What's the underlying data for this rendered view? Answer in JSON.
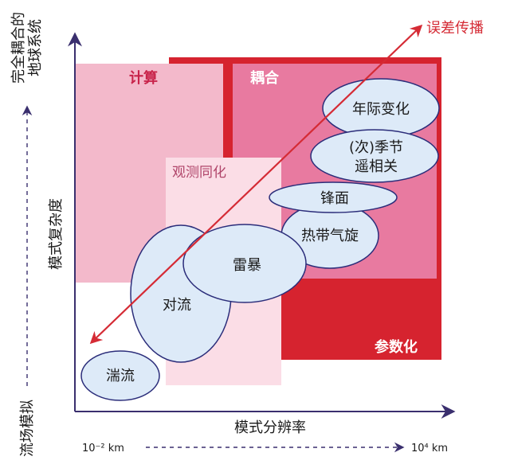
{
  "labels": {
    "compute": "计算",
    "coupling": "耦合",
    "assimilation": "观测同化",
    "parameterization": "参数化",
    "error_propagation": "误差传播",
    "x_axis": "模式分辨率",
    "y_axis": "模式复杂度",
    "x_min": "10⁻² km",
    "x_max": "10⁴ km",
    "top_left_line1": "完全耦合的",
    "top_left_line2": "地球系统",
    "bottom_left": "流场模拟"
  },
  "phenomena": {
    "interannual": "年际变化",
    "subseasonal_line1": "(次)季节",
    "subseasonal_line2": "遥相关",
    "front": "锋面",
    "tropical_cyclone": "热带气旋",
    "thunderstorm": "雷暴",
    "convection": "对流",
    "turbulence": "湍流"
  },
  "colors": {
    "axis": "#3a2f6e",
    "compute_fill": "#f3b9cb",
    "coupling_frame": "#d6232f",
    "coupling_fill": "#e87aa0",
    "assimilation_fill": "#fbdde6",
    "ellipse_fill": "#ddeaf8",
    "ellipse_stroke": "#2b2d7a",
    "arrow": "#d52b35"
  }
}
